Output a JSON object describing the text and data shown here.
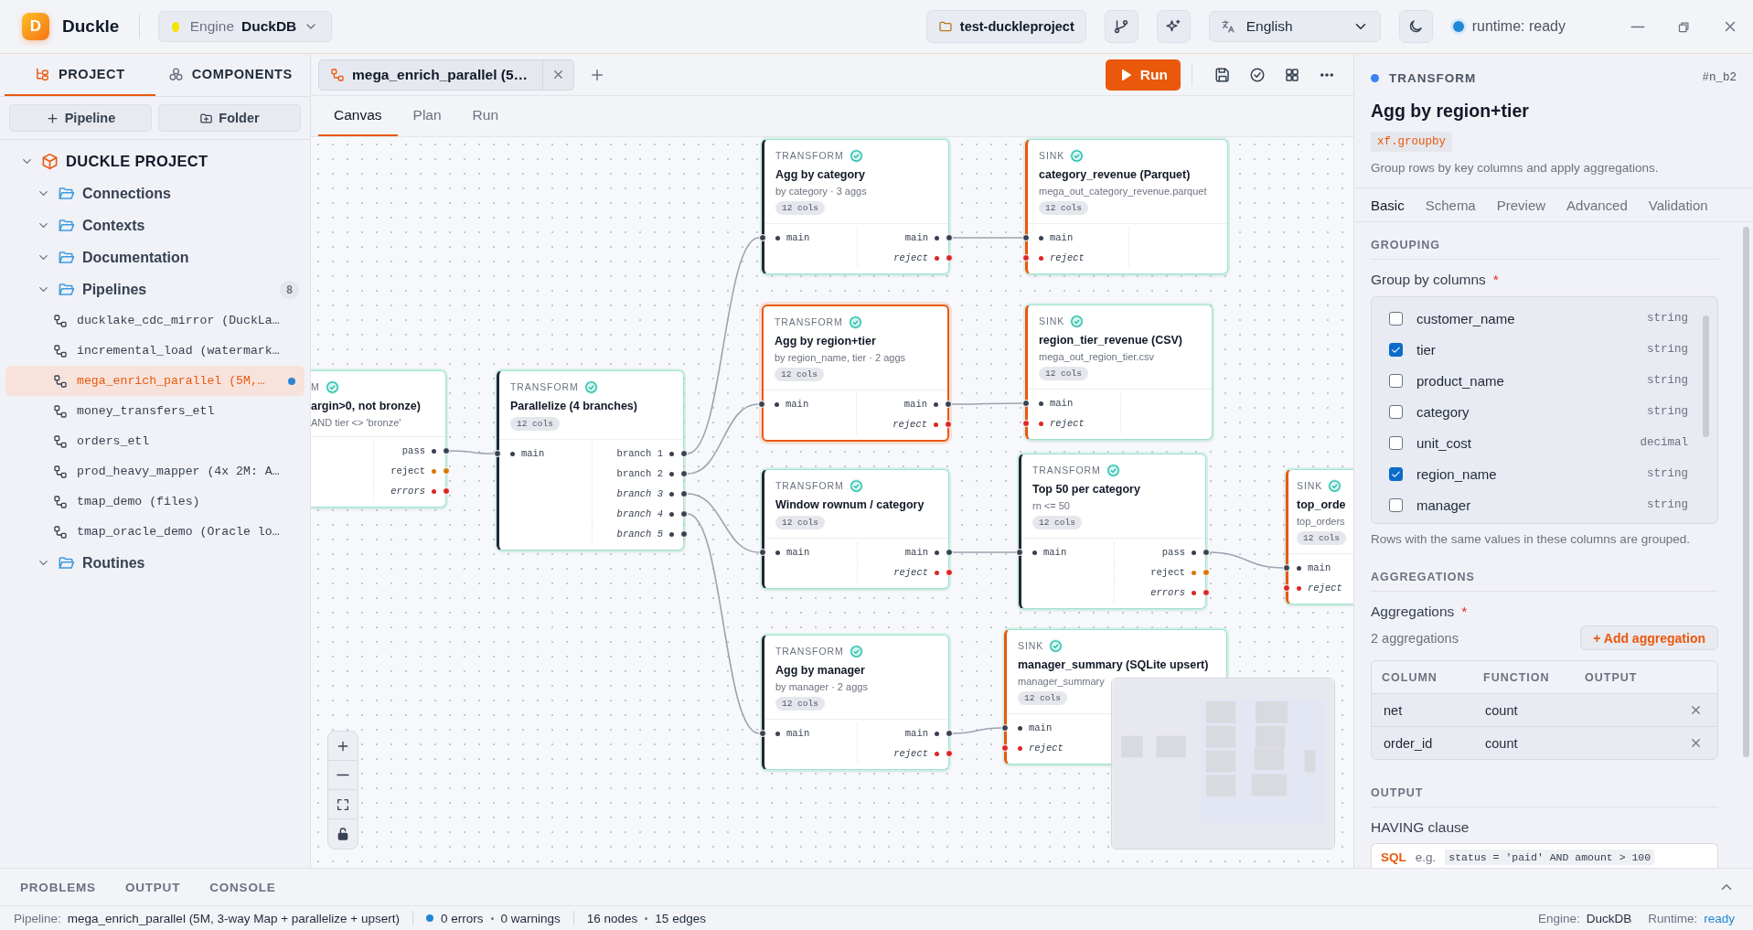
{
  "app": {
    "name": "Duckle",
    "logo_letter": "D"
  },
  "engine_select": {
    "label": "Engine",
    "value": "DuckDB"
  },
  "toolbar": {
    "project": "test-duckleproject",
    "language": "English",
    "runtime_status": "runtime: ready"
  },
  "sidebar": {
    "tabs": [
      {
        "label": "PROJECT",
        "selected": true
      },
      {
        "label": "COMPONENTS",
        "selected": false
      }
    ],
    "buttons": [
      "Pipeline",
      "Folder"
    ],
    "tree": [
      {
        "label": "DUCKLE PROJECT",
        "kind": "project",
        "expanded": true,
        "children": [
          {
            "label": "Connections",
            "kind": "folder",
            "expanded": true
          },
          {
            "label": "Contexts",
            "kind": "folder",
            "expanded": true
          },
          {
            "label": "Documentation",
            "kind": "folder",
            "expanded": true
          },
          {
            "label": "Pipelines",
            "kind": "folder",
            "expanded": true,
            "count": "8",
            "children": [
              {
                "label": "ducklake_cdc_mirror (DuckLa…",
                "kind": "pipeline",
                "selected": false,
                "modified": false
              },
              {
                "label": "incremental_load (watermark…",
                "kind": "pipeline",
                "selected": false,
                "modified": false
              },
              {
                "label": "mega_enrich_parallel (5M,…",
                "kind": "pipeline",
                "selected": true,
                "modified": true
              },
              {
                "label": "money_transfers_etl",
                "kind": "pipeline",
                "selected": false,
                "modified": false
              },
              {
                "label": "orders_etl",
                "kind": "pipeline",
                "selected": false,
                "modified": false
              },
              {
                "label": "prod_heavy_mapper (4x 2M: A…",
                "kind": "pipeline",
                "selected": false,
                "modified": false
              },
              {
                "label": "tmap_demo (files)",
                "kind": "pipeline",
                "selected": false,
                "modified": false
              },
              {
                "label": "tmap_oracle_demo (Oracle lo…",
                "kind": "pipeline",
                "selected": false,
                "modified": false
              }
            ]
          },
          {
            "label": "Routines",
            "kind": "folder",
            "expanded": true
          }
        ]
      }
    ]
  },
  "editor": {
    "tabs": [
      {
        "label": "mega_enrich_parallel (5…"
      }
    ],
    "run_button": "Run",
    "view_tabs": [
      {
        "label": "Canvas",
        "selected": true
      },
      {
        "label": "Plan",
        "selected": false
      },
      {
        "label": "Run",
        "selected": false
      }
    ],
    "nodes": [
      {
        "kind": "transform",
        "type_label": "M",
        "title": "argin>0, not bronze)",
        "subtitle": "AND tier <> 'bronze'",
        "valid": true,
        "selected": false,
        "outputs": [
          {
            "name": "pass",
            "color": "#374151",
            "italic": false
          },
          {
            "name": "reject",
            "color": "#d97706",
            "italic": false
          },
          {
            "name": "errors",
            "color": "#dc2626",
            "italic": true
          }
        ]
      },
      {
        "kind": "transform",
        "type_label": "TRANSFORM",
        "title": "Parallelize (4 branches)",
        "badge": "12 cols",
        "valid": true,
        "selected": false,
        "inputs": [
          {
            "name": "main",
            "color": "#374151",
            "italic": false
          }
        ],
        "outputs": [
          {
            "name": "branch 1",
            "color": "#374151",
            "italic": false
          },
          {
            "name": "branch 2",
            "color": "#374151",
            "italic": false
          },
          {
            "name": "branch 3",
            "color": "#374151",
            "italic": true
          },
          {
            "name": "branch 4",
            "color": "#374151",
            "italic": true
          },
          {
            "name": "branch 5",
            "color": "#374151",
            "italic": true
          }
        ]
      },
      {
        "kind": "transform",
        "type_label": "TRANSFORM",
        "title": "Agg by category",
        "subtitle": "by category · 3 aggs",
        "badge": "12 cols",
        "valid": true,
        "selected": false,
        "inputs": [
          {
            "name": "main",
            "color": "#374151",
            "italic": false
          }
        ],
        "outputs": [
          {
            "name": "main",
            "color": "#374151",
            "italic": false
          },
          {
            "name": "reject",
            "color": "#dc2626",
            "italic": true
          }
        ]
      },
      {
        "kind": "sink",
        "type_label": "SINK",
        "title": "category_revenue (Parquet)",
        "subtitle": "mega_out_category_revenue.parquet",
        "badge": "12 cols",
        "valid": true,
        "selected": false,
        "inputs": [
          {
            "name": "main",
            "color": "#374151",
            "italic": false
          },
          {
            "name": "reject",
            "color": "#dc2626",
            "italic": true
          }
        ]
      },
      {
        "kind": "transform",
        "type_label": "TRANSFORM",
        "title": "Agg by region+tier",
        "subtitle": "by region_name, tier · 2 aggs",
        "badge": "12 cols",
        "valid": true,
        "selected": true,
        "inputs": [
          {
            "name": "main",
            "color": "#374151",
            "italic": false
          }
        ],
        "outputs": [
          {
            "name": "main",
            "color": "#374151",
            "italic": false
          },
          {
            "name": "reject",
            "color": "#dc2626",
            "italic": true
          }
        ]
      },
      {
        "kind": "sink",
        "type_label": "SINK",
        "title": "region_tier_revenue (CSV)",
        "subtitle": "mega_out_region_tier.csv",
        "badge": "12 cols",
        "valid": true,
        "selected": false,
        "inputs": [
          {
            "name": "main",
            "color": "#374151",
            "italic": false
          },
          {
            "name": "reject",
            "color": "#dc2626",
            "italic": true
          }
        ]
      },
      {
        "kind": "transform",
        "type_label": "TRANSFORM",
        "title": "Window rownum / category",
        "badge": "12 cols",
        "valid": true,
        "selected": false,
        "inputs": [
          {
            "name": "main",
            "color": "#374151",
            "italic": false
          }
        ],
        "outputs": [
          {
            "name": "main",
            "color": "#374151",
            "italic": false
          },
          {
            "name": "reject",
            "color": "#dc2626",
            "italic": true
          }
        ]
      },
      {
        "kind": "transform",
        "type_label": "TRANSFORM",
        "title": "Top 50 per category",
        "subtitle": "rn <= 50",
        "badge": "12 cols",
        "valid": true,
        "selected": false,
        "inputs": [
          {
            "name": "main",
            "color": "#374151",
            "italic": false
          }
        ],
        "outputs": [
          {
            "name": "pass",
            "color": "#374151",
            "italic": false
          },
          {
            "name": "reject",
            "color": "#d97706",
            "italic": false
          },
          {
            "name": "errors",
            "color": "#dc2626",
            "italic": true
          }
        ]
      },
      {
        "kind": "sink",
        "type_label": "SINK",
        "title": "top_orde",
        "subtitle": "top_orders",
        "badge": "12 cols",
        "valid": true,
        "selected": false,
        "inputs": [
          {
            "name": "main",
            "color": "#374151",
            "italic": false
          },
          {
            "name": "reject",
            "color": "#dc2626",
            "italic": true
          }
        ]
      },
      {
        "kind": "transform",
        "type_label": "TRANSFORM",
        "title": "Agg by manager",
        "subtitle": "by manager · 2 aggs",
        "badge": "12 cols",
        "valid": true,
        "selected": false,
        "inputs": [
          {
            "name": "main",
            "color": "#374151",
            "italic": false
          }
        ],
        "outputs": [
          {
            "name": "main",
            "color": "#374151",
            "italic": false
          },
          {
            "name": "reject",
            "color": "#dc2626",
            "italic": true
          }
        ]
      },
      {
        "kind": "sink",
        "type_label": "SINK",
        "title": "manager_summary (SQLite upsert)",
        "subtitle": "manager_summary",
        "badge": "12 cols",
        "valid": true,
        "selected": false,
        "inputs": [
          {
            "name": "main",
            "color": "#374151",
            "italic": false
          },
          {
            "name": "reject",
            "color": "#dc2626",
            "italic": true
          }
        ]
      }
    ]
  },
  "inspector": {
    "kind_label": "TRANSFORM",
    "node_id": "#n_b2",
    "title": "Agg by region+tier",
    "code": "xf.groupby",
    "description": "Group rows by key columns and apply aggregations.",
    "tabs": [
      {
        "label": "Basic",
        "selected": true
      },
      {
        "label": "Schema",
        "selected": false
      },
      {
        "label": "Preview",
        "selected": false
      },
      {
        "label": "Advanced",
        "selected": false
      },
      {
        "label": "Validation",
        "selected": false
      }
    ],
    "grouping": {
      "heading": "GROUPING",
      "label": "Group by columns",
      "required": "*",
      "columns": [
        {
          "name": "customer_name",
          "type": "string",
          "checked": false
        },
        {
          "name": "tier",
          "type": "string",
          "checked": true
        },
        {
          "name": "product_name",
          "type": "string",
          "checked": false
        },
        {
          "name": "category",
          "type": "string",
          "checked": false
        },
        {
          "name": "unit_cost",
          "type": "decimal",
          "checked": false
        },
        {
          "name": "region_name",
          "type": "string",
          "checked": true
        },
        {
          "name": "manager",
          "type": "string",
          "checked": false
        }
      ],
      "hint": "Rows with the same values in these columns are grouped."
    },
    "aggregations": {
      "heading": "AGGREGATIONS",
      "label": "Aggregations",
      "required": "*",
      "count": "2 aggregations",
      "add_button": "+ Add aggregation",
      "columns": [
        "COLUMN",
        "FUNCTION",
        "OUTPUT"
      ],
      "rows": [
        {
          "column": "net",
          "function": "count"
        },
        {
          "column": "order_id",
          "function": "count"
        }
      ]
    },
    "output": {
      "heading": "OUTPUT",
      "label": "HAVING clause",
      "language": "SQL",
      "hint_prefix": "e.g.",
      "hint_code": "status = 'paid' AND amount > 100"
    }
  },
  "bottom_panel": {
    "tabs": [
      {
        "label": "PROBLEMS",
        "selected": false
      },
      {
        "label": "OUTPUT",
        "selected": false
      },
      {
        "label": "CONSOLE",
        "selected": false
      }
    ]
  },
  "status_bar": {
    "pipeline_label": "Pipeline:",
    "pipeline": "mega_enrich_parallel (5M, 3-way Map + parallelize + upsert)",
    "problems": [
      "0 errors",
      "0 warnings"
    ],
    "counts": [
      "16 nodes",
      "15 edges"
    ],
    "engine_label": "Engine:",
    "engine": "DuckDB",
    "runtime_label": "Runtime:",
    "runtime": "ready"
  }
}
